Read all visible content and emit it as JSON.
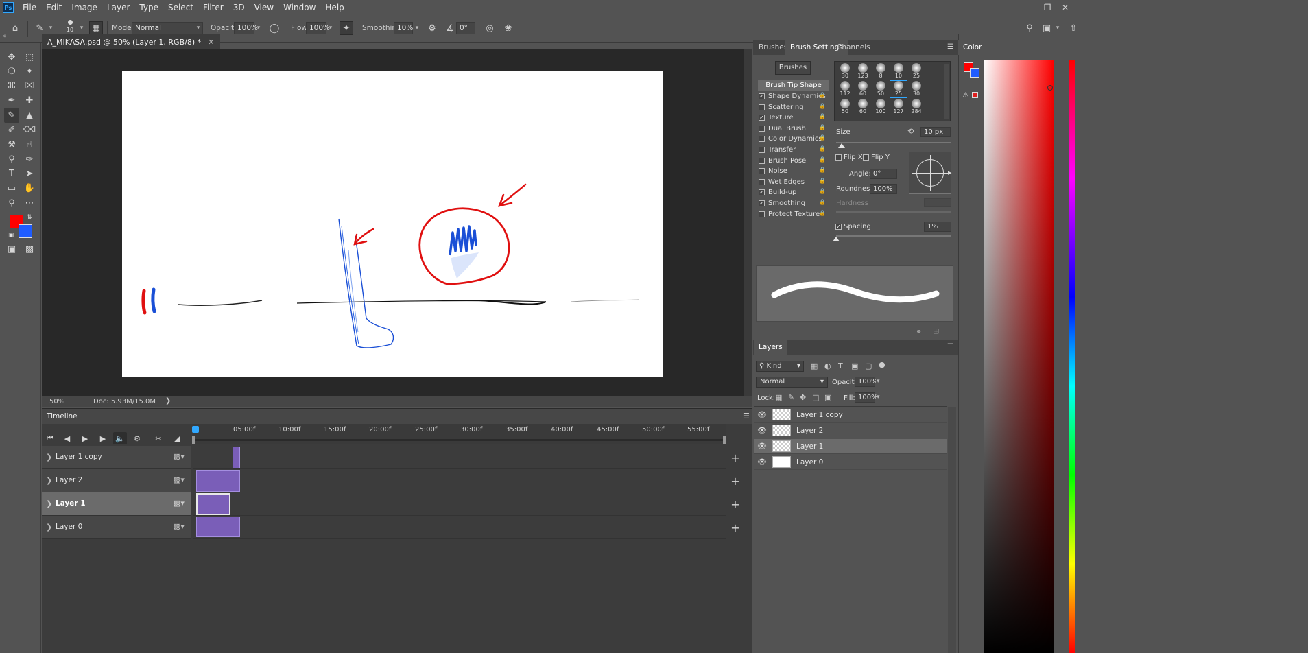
{
  "menu": [
    "File",
    "Edit",
    "Image",
    "Layer",
    "Type",
    "Select",
    "Filter",
    "3D",
    "View",
    "Window",
    "Help"
  ],
  "app_logo": "Ps",
  "options": {
    "brush_size": "10",
    "mode_label": "Mode:",
    "mode_value": "Normal",
    "opacity_label": "Opacity:",
    "opacity_value": "100%",
    "flow_label": "Flow:",
    "flow_value": "100%",
    "smoothing_label": "Smoothing:",
    "smoothing_value": "10%",
    "angle_value": "0°"
  },
  "document": {
    "tab_title": "A_MIKASA.psd @ 50% (Layer 1, RGB/8) *",
    "zoom": "50%",
    "doc_info": "Doc: 5.93M/15.0M"
  },
  "timeline": {
    "title": "Timeline",
    "ticks": [
      "05:00f",
      "10:00f",
      "15:00f",
      "20:00f",
      "25:00f",
      "30:00f",
      "35:00f",
      "40:00f",
      "45:00f",
      "50:00f",
      "55:00f"
    ],
    "tracks": [
      "Layer 1 copy",
      "Layer 2",
      "Layer 1",
      "Layer 0"
    ]
  },
  "brush_panel": {
    "tabs": [
      "Brushes",
      "Brush Settings",
      "Channels"
    ],
    "brushes_button": "Brushes",
    "tip_shape": "Brush Tip Shape",
    "settings": [
      {
        "label": "Shape Dynamics",
        "checked": true
      },
      {
        "label": "Scattering",
        "checked": false
      },
      {
        "label": "Texture",
        "checked": true
      },
      {
        "label": "Dual Brush",
        "checked": false
      },
      {
        "label": "Color Dynamics",
        "checked": false
      },
      {
        "label": "Transfer",
        "checked": false
      },
      {
        "label": "Brush Pose",
        "checked": false
      },
      {
        "label": "Noise",
        "checked": false
      },
      {
        "label": "Wet Edges",
        "checked": false
      },
      {
        "label": "Build-up",
        "checked": true
      },
      {
        "label": "Smoothing",
        "checked": true
      },
      {
        "label": "Protect Texture",
        "checked": false
      }
    ],
    "tip_sizes": [
      "30",
      "123",
      "8",
      "10",
      "25",
      "112",
      "60",
      "50",
      "25",
      "30",
      "50",
      "60",
      "100",
      "127",
      "284"
    ],
    "size_label": "Size",
    "size_value": "10 px",
    "flip_x": "Flip X",
    "flip_y": "Flip Y",
    "angle_label": "Angle:",
    "angle_value": "0°",
    "roundness_label": "Roundness:",
    "roundness_value": "100%",
    "hardness_label": "Hardness",
    "spacing_label": "Spacing",
    "spacing_value": "1%"
  },
  "layers_panel": {
    "title": "Layers",
    "kind_label": "Kind",
    "blend_mode": "Normal",
    "opacity_label": "Opacity:",
    "opacity_value": "100%",
    "lock_label": "Lock:",
    "fill_label": "Fill:",
    "fill_value": "100%",
    "layers": [
      {
        "name": "Layer 1 copy",
        "selected": false
      },
      {
        "name": "Layer 2",
        "selected": false
      },
      {
        "name": "Layer 1",
        "selected": true
      },
      {
        "name": "Layer 0",
        "selected": false
      }
    ]
  },
  "color_panel": {
    "title": "Color",
    "foreground": "#ff0000",
    "background": "#1f5cff"
  },
  "colors": {
    "accent_clip": "#7a5eb8",
    "playhead": "#31a8ff",
    "stroke_red": "#e01010",
    "stroke_blue": "#1a4fd6"
  }
}
